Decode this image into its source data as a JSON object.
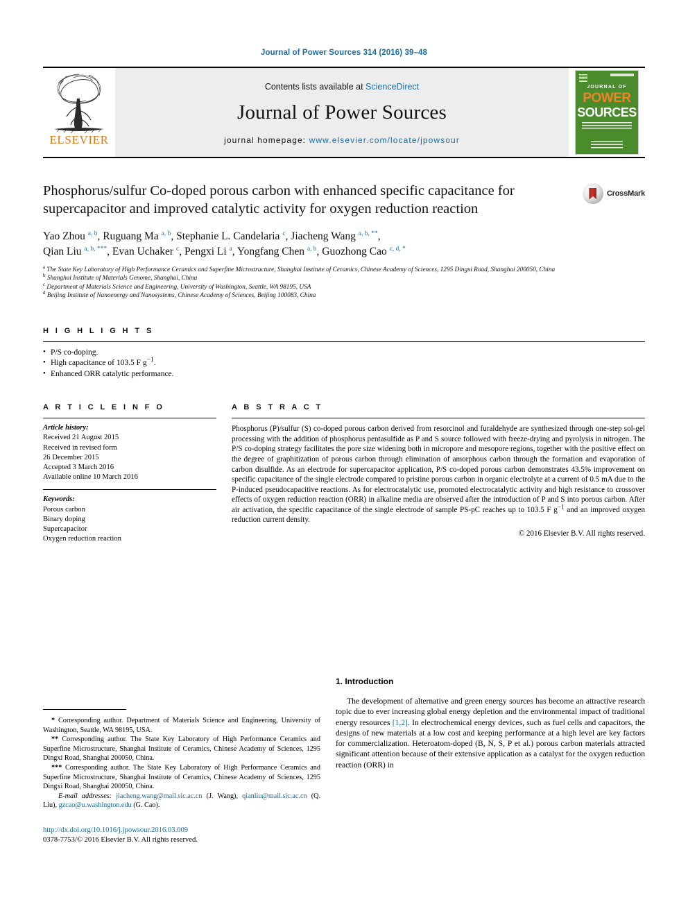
{
  "running_head": "Journal of Power Sources 314 (2016) 39–48",
  "masthead": {
    "publisher": "ELSEVIER",
    "contents_prefix": "Contents lists available at ",
    "contents_link": "ScienceDirect",
    "journal_title": "Journal of Power Sources",
    "homepage_prefix": "journal homepage: ",
    "homepage_url": "www.elsevier.com/locate/jpowsour",
    "cover": {
      "line1": "JOURNAL OF",
      "line2": "POWER",
      "line3": "SOURCES"
    }
  },
  "article": {
    "title": "Phosphorus/sulfur Co-doped porous carbon with enhanced specific capacitance for supercapacitor and improved catalytic activity for oxygen reduction reaction",
    "crossmark_label": "CrossMark",
    "authors_html": "Yao Zhou <sup>a, b</sup>, Ruguang Ma <sup>a, b</sup>, Stephanie L. Candelaria <sup>c</sup>, Jiacheng Wang <sup>a, b, **</sup>,<br>Qian Liu <sup>a, b, ***</sup>, Evan Uchaker <sup>c</sup>, Pengxi Li <sup>a</sup>, Yongfang Chen <sup>a, b</sup>, Guozhong Cao <sup>c, d, *</sup>",
    "affiliations": [
      "<sup>a</sup> The State Key Laboratory of High Performance Ceramics and Superfine Microstructure, Shanghai Institute of Ceramics, Chinese Academy of Sciences, 1295 Dingxi Road, Shanghai 200050, China",
      "<sup>b</sup> Shanghai Institute of Materials Genome, Shanghai, China",
      "<sup>c</sup> Department of Materials Science and Engineering, University of Washington, Seattle, WA 98195, USA",
      "<sup>d</sup> Beijing Institute of Nanoenergy and Nanosystems, Chinese Academy of Sciences, Beijing 100083, China"
    ]
  },
  "highlights": {
    "heading": "H I G H L I G H T S",
    "items": [
      "P/S co-doping.",
      "High capacitance of 103.5 F g<sup>−1</sup>.",
      "Enhanced ORR catalytic performance."
    ]
  },
  "article_info": {
    "heading": "A R T I C L E   I N F O",
    "history_label": "Article history:",
    "history": [
      "Received 21 August 2015",
      "Received in revised form",
      "26 December 2015",
      "Accepted 3 March 2016",
      "Available online 10 March 2016"
    ],
    "keywords_label": "Keywords:",
    "keywords": [
      "Porous carbon",
      "Binary doping",
      "Supercapacitor",
      "Oxygen reduction reaction"
    ]
  },
  "abstract": {
    "heading": "A B S T R A C T",
    "text_html": "Phosphorus (P)/sulfur (S) co-doped porous carbon derived from resorcinol and furaldehyde are synthesized through one-step sol-gel processing with the addition of phosphorus pentasulfide as P and S source followed with freeze-drying and pyrolysis in nitrogen. The P/S co-doping strategy facilitates the pore size widening both in micropore and mesopore regions, together with the positive effect on the degree of graphitization of porous carbon through elimination of amorphous carbon through the formation and evaporation of carbon disulfide. As an electrode for supercapacitor application, P/S co-doped porous carbon demonstrates 43.5% improvement on specific capacitance of the single electrode compared to pristine porous carbon in organic electrolyte at a current of 0.5 mA due to the P-induced pseudocapacitive reactions. As for electrocatalytic use, promoted electrocatalytic activity and high resistance to crossover effects of oxygen reduction reaction (ORR) in alkaline media are observed after the introduction of P and S into porous carbon. After air activation, the specific capacitance of the single electrode of sample PS-pC reaches up to 103.5 F g<sup>−1</sup> and an improved oxygen reduction current density.",
    "copyright": "© 2016 Elsevier B.V. All rights reserved."
  },
  "footnotes": {
    "corr1": "<b>*</b> Corresponding author. Department of Materials Science and Engineering, University of Washington, Seattle, WA 98195, USA.",
    "corr2": "<b>**</b> Corresponding author. The State Key Laboratory of High Performance Ceramics and Superfine Microstructure, Shanghai Institute of Ceramics, Chinese Academy of Sciences, 1295 Dingxi Road, Shanghai 200050, China.",
    "corr3": "<b>***</b> Corresponding author. The State Key Laboratory of High Performance Ceramics and Superfine Microstructure, Shanghai Institute of Ceramics, Chinese Academy of Sciences, 1295 Dingxi Road, Shanghai 200050, China.",
    "email_label": "E-mail addresses:",
    "email1": "jiacheng.wang@mail.sic.ac.cn",
    "email1_owner": "(J. Wang),",
    "email2": "qianliu@mail.sic.ac.cn",
    "email2_owner": "(Q. Liu),",
    "email3": "gzcao@u.washington.edu",
    "email3_owner": "(G. Cao)."
  },
  "doi_block": {
    "doi_url": "http://dx.doi.org/10.1016/j.jpowsour.2016.03.009",
    "issn_line": "0378-7753/© 2016 Elsevier B.V. All rights reserved."
  },
  "introduction": {
    "heading": "1. Introduction",
    "paragraph_html": "The development of alternative and green energy sources has become an attractive research topic due to ever increasing global energy depletion and the environmental impact of traditional energy resources <span class=\"link\">[1,2]</span>. In electrochemical energy devices, such as fuel cells and capacitors, the designs of new materials at a low cost and keeping performance at a high level are key factors for commercialization. Heteroatom-doped (B, N, S, P et al.) porous carbon materials attracted significant attention because of their extensive application as a catalyst for the oxygen reduction reaction (ORR) in"
  },
  "colors": {
    "link_blue": "#1a6ba0",
    "elsevier_orange": "#E8760B",
    "cover_green": "#4a8b2c",
    "crossmark_red": "#b02a1c"
  }
}
